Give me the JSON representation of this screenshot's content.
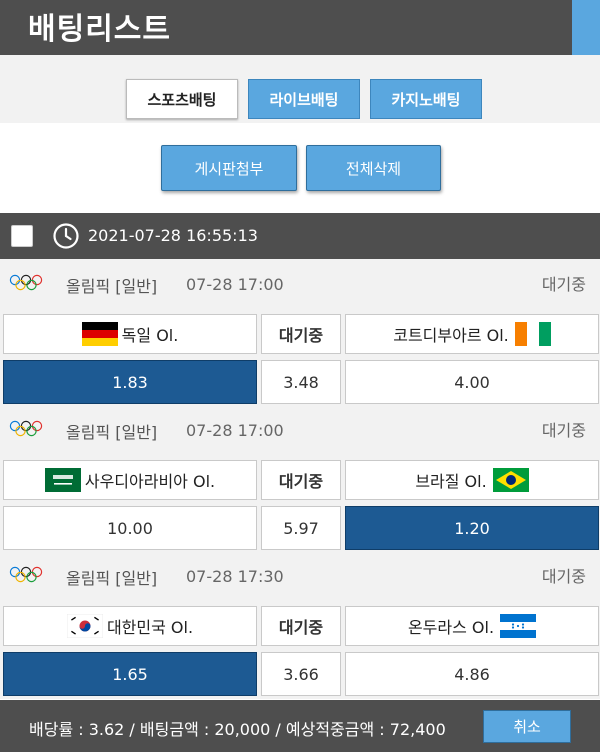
{
  "header": {
    "title": "배팅리스트"
  },
  "tabs": [
    {
      "label": "스포츠배팅",
      "active": true
    },
    {
      "label": "라이브배팅",
      "active": false
    },
    {
      "label": "카지노배팅",
      "active": false
    }
  ],
  "actions": {
    "attach_label": "게시판첨부",
    "delete_label": "전체삭제"
  },
  "bet": {
    "datetime": "2021-07-28 16:55:13"
  },
  "matches": [
    {
      "league": "올림픽 [일반]",
      "time": "07-28 17:00",
      "status": "대기중",
      "home": {
        "name": "독일 Ol.",
        "flag": "germany-flag"
      },
      "draw_label": "대기중",
      "away": {
        "name": "코트디부아르 Ol.",
        "flag": "ivory-coast-flag"
      },
      "odds": {
        "home": "1.83",
        "draw": "3.48",
        "away": "4.00"
      },
      "selected": "home"
    },
    {
      "league": "올림픽 [일반]",
      "time": "07-28 17:00",
      "status": "대기중",
      "home": {
        "name": "사우디아라비아 Ol.",
        "flag": "saudi-arabia-flag"
      },
      "draw_label": "대기중",
      "away": {
        "name": "브라질 Ol.",
        "flag": "brazil-flag"
      },
      "odds": {
        "home": "10.00",
        "draw": "5.97",
        "away": "1.20"
      },
      "selected": "away"
    },
    {
      "league": "올림픽 [일반]",
      "time": "07-28 17:30",
      "status": "대기중",
      "home": {
        "name": "대한민국 Ol.",
        "flag": "south-korea-flag"
      },
      "draw_label": "대기중",
      "away": {
        "name": "온두라스 Ol.",
        "flag": "honduras-flag"
      },
      "odds": {
        "home": "1.65",
        "draw": "3.66",
        "away": "4.86"
      },
      "selected": "home"
    }
  ],
  "footer": {
    "summary": "배당률 : 3.62 / 배팅금액 : 20,000 / 예상적중금액 : 72,400",
    "cancel_label": "취소"
  },
  "colors": {
    "header_bg": "#4e4e4e",
    "accent_blue": "#5aa7df",
    "selected_odd": "#1d5a93",
    "row_bg": "#f2f2f2"
  },
  "icons": {
    "clock": "clock-icon",
    "league": "olympic-rings-icon",
    "checkbox": "checkbox"
  }
}
